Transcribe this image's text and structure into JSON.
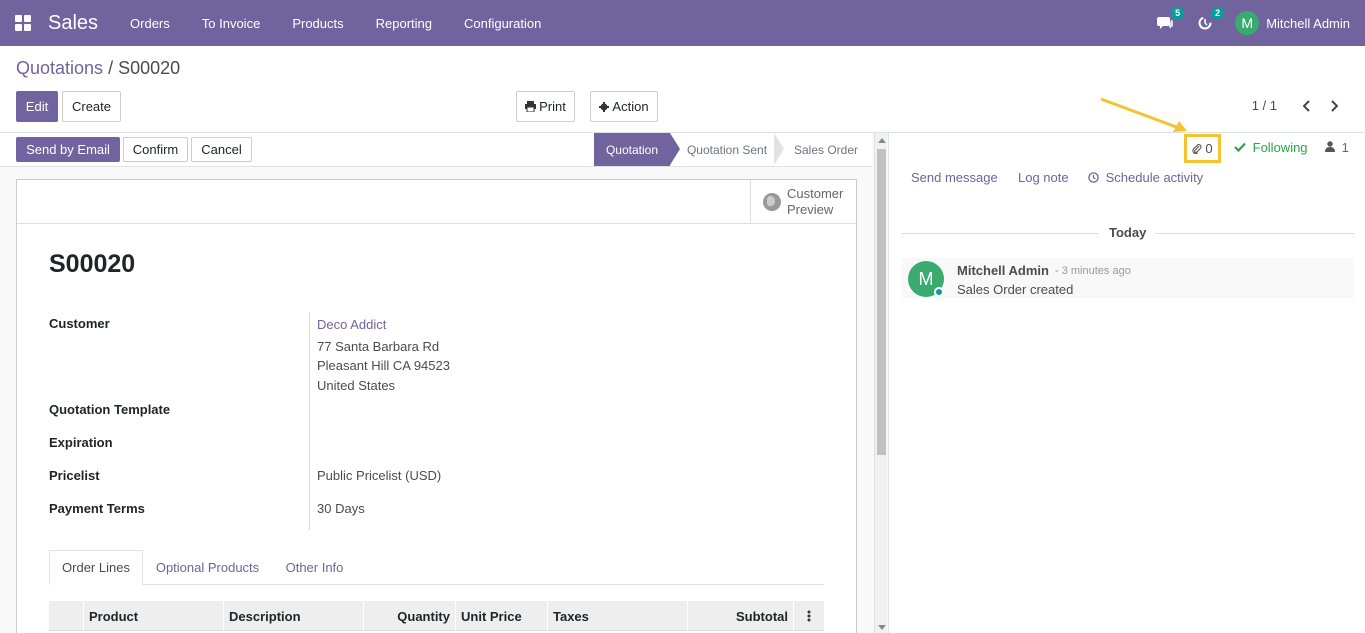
{
  "navbar": {
    "app_name": "Sales",
    "menu": [
      "Orders",
      "To Invoice",
      "Products",
      "Reporting",
      "Configuration"
    ],
    "messages_badge": "5",
    "activities_badge": "2",
    "user_initial": "M",
    "user_name": "Mitchell Admin"
  },
  "breadcrumb": {
    "parent": "Quotations",
    "separator": "/",
    "current": "S00020"
  },
  "control_panel": {
    "edit_label": "Edit",
    "create_label": "Create",
    "print_label": "Print",
    "action_label": "Action",
    "pager": "1 / 1"
  },
  "statusbar": {
    "send_email_label": "Send by Email",
    "confirm_label": "Confirm",
    "cancel_label": "Cancel",
    "stages": [
      "Quotation",
      "Quotation Sent",
      "Sales Order"
    ],
    "active_stage": "Quotation"
  },
  "form": {
    "customer_preview_line1": "Customer",
    "customer_preview_line2": "Preview",
    "title": "S00020",
    "fields": {
      "customer_label": "Customer",
      "customer_name": "Deco Addict",
      "address_line1": "77 Santa Barbara Rd",
      "address_line2": "Pleasant Hill CA 94523",
      "address_line3": "United States",
      "template_label": "Quotation Template",
      "expiration_label": "Expiration",
      "pricelist_label": "Pricelist",
      "pricelist_value": "Public Pricelist (USD)",
      "payment_terms_label": "Payment Terms",
      "payment_terms_value": "30 Days"
    },
    "tabs": [
      "Order Lines",
      "Optional Products",
      "Other Info"
    ],
    "active_tab": "Order Lines",
    "table_headers": [
      "Product",
      "Description",
      "Quantity",
      "Unit Price",
      "Taxes",
      "Subtotal"
    ]
  },
  "chatter": {
    "attachments_count": "0",
    "following_label": "Following",
    "followers_count": "1",
    "send_message_label": "Send message",
    "log_note_label": "Log note",
    "schedule_activity_label": "Schedule activity",
    "date_separator": "Today",
    "messages": [
      {
        "author_initial": "M",
        "author": "Mitchell Admin",
        "time": "- 3 minutes ago",
        "body": "Sales Order created"
      }
    ]
  },
  "colors": {
    "brand": "#71639e",
    "highlight": "#f4c430",
    "following": "#28a745",
    "badge": "#00a09d"
  }
}
